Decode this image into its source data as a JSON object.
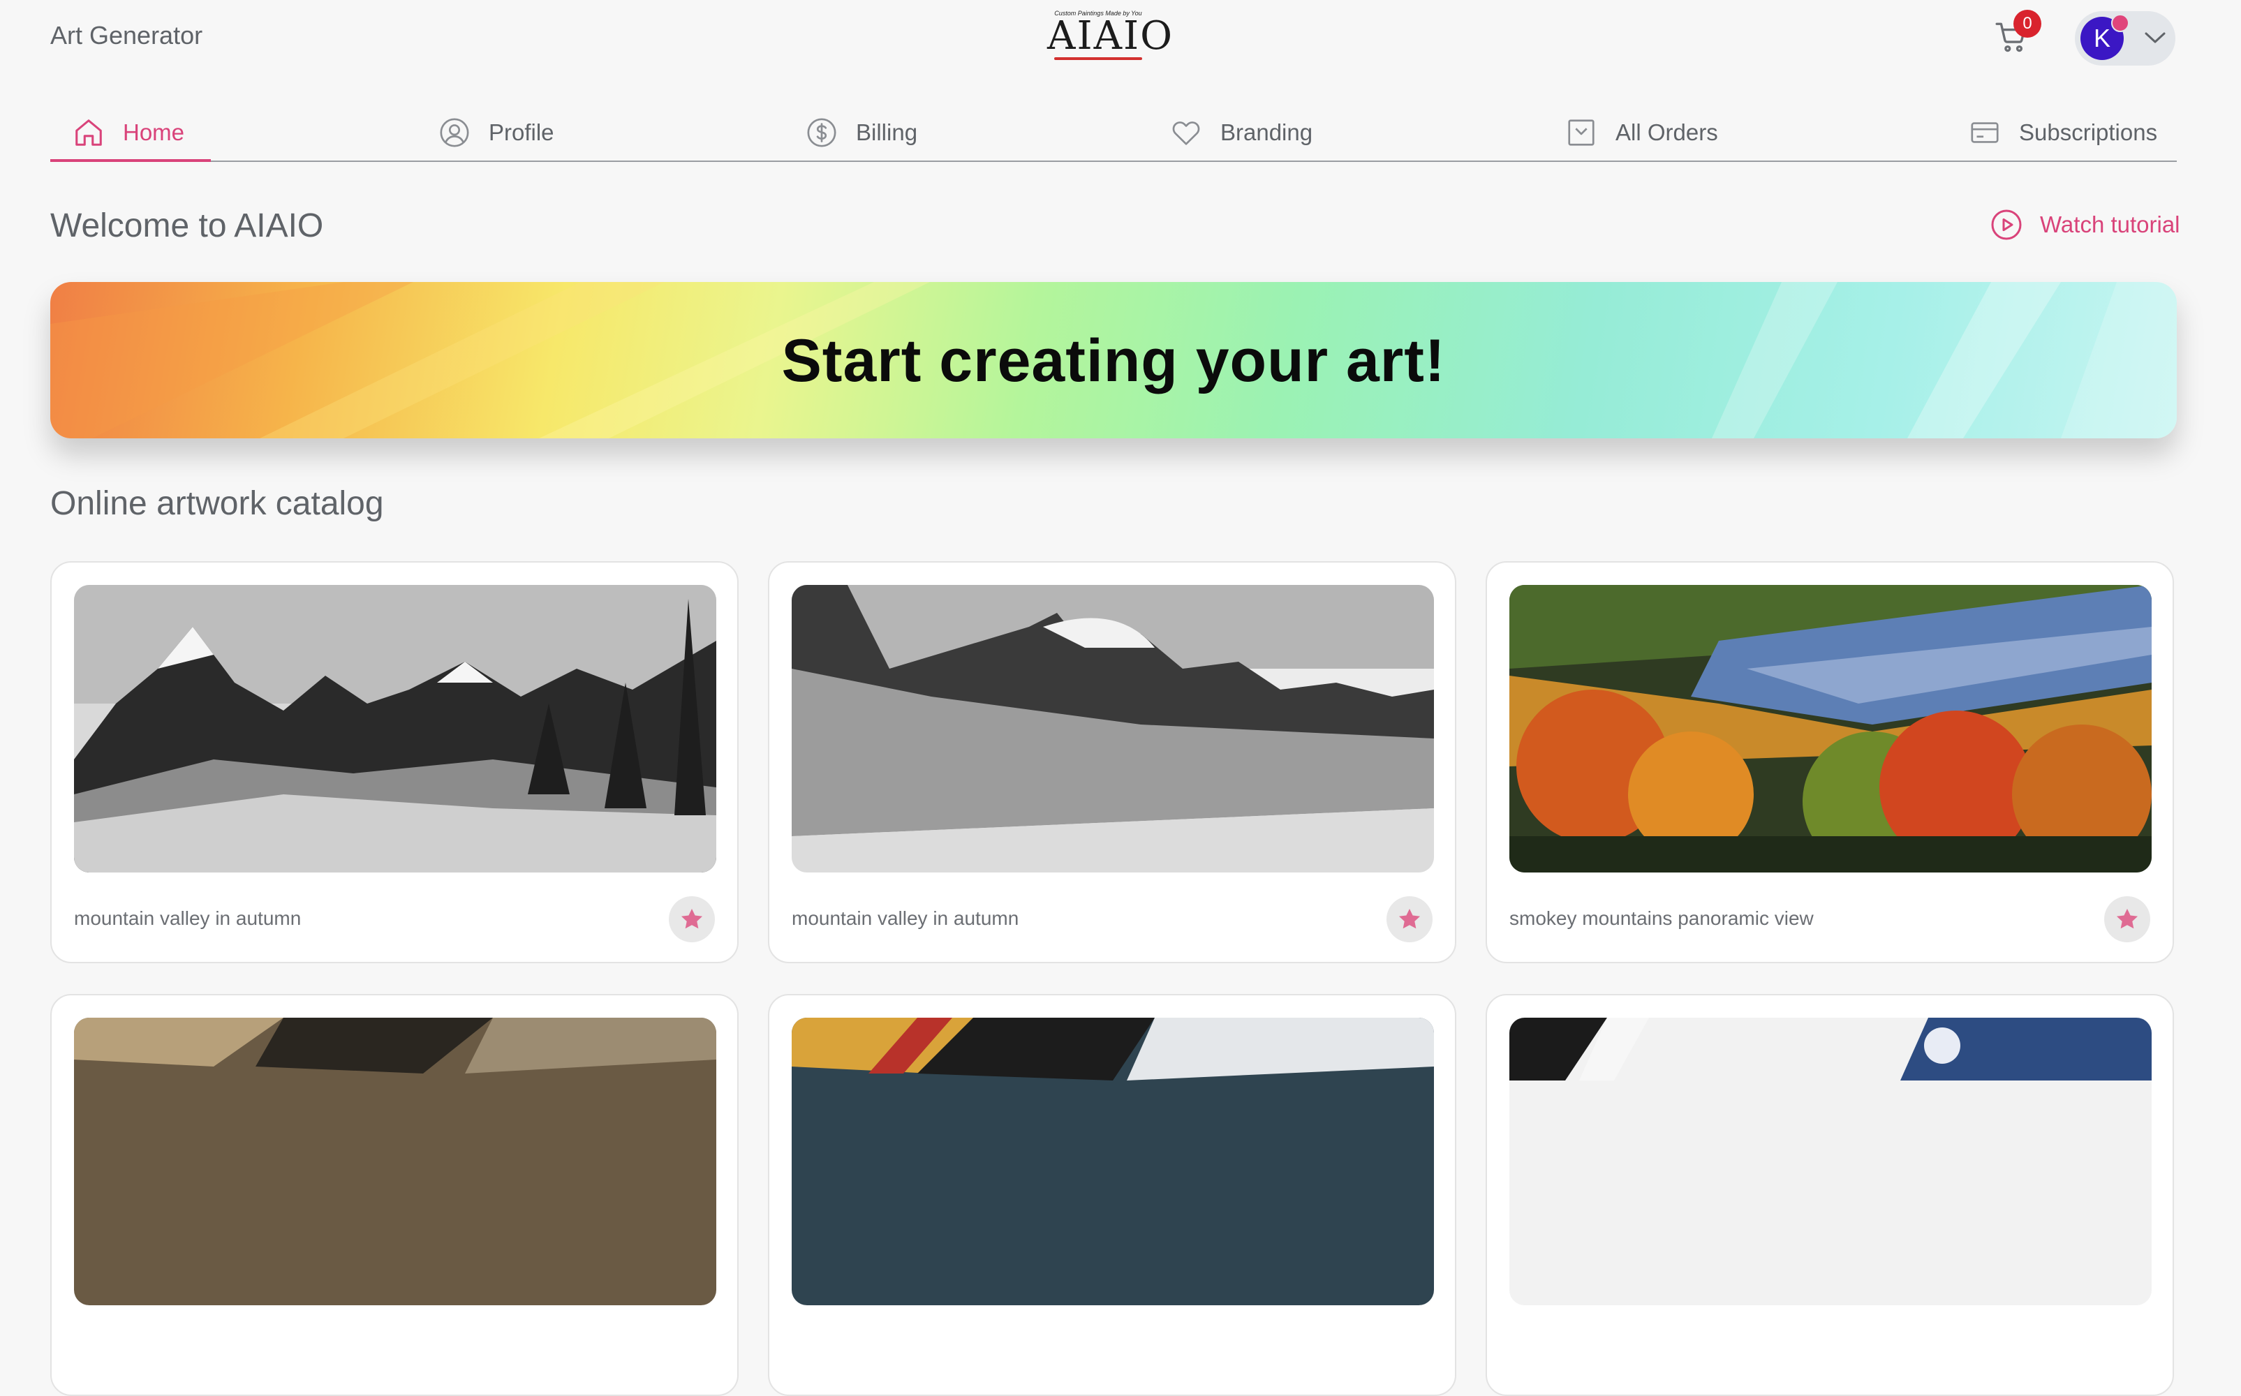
{
  "header": {
    "app_title": "Art Generator",
    "logo": {
      "tagline": "Custom Paintings Made by You",
      "wordmark": "AIAIO"
    },
    "cart": {
      "count": "0"
    },
    "account": {
      "initial": "K"
    }
  },
  "nav": {
    "items": [
      {
        "label": "Home",
        "icon": "home-icon",
        "active": true
      },
      {
        "label": "Profile",
        "icon": "user-circle-icon"
      },
      {
        "label": "Billing",
        "icon": "dollar-circle-icon"
      },
      {
        "label": "Branding",
        "icon": "heart-icon"
      },
      {
        "label": "All Orders",
        "icon": "inbox-icon"
      },
      {
        "label": "Subscriptions",
        "icon": "card-icon"
      }
    ]
  },
  "main": {
    "welcome": "Welcome to AIAIO",
    "tutorial_label": "Watch tutorial",
    "banner_text": "Start creating your art!",
    "catalog_title": "Online artwork catalog",
    "cards": [
      {
        "caption": "mountain valley in autumn"
      },
      {
        "caption": "mountain valley in autumn"
      },
      {
        "caption": "smokey mountains panoramic view"
      },
      {
        "caption": ""
      },
      {
        "caption": ""
      },
      {
        "caption": ""
      }
    ]
  },
  "colors": {
    "accent": "#d9437a",
    "badge": "#d9232d",
    "avatar": "#3b17c4"
  }
}
